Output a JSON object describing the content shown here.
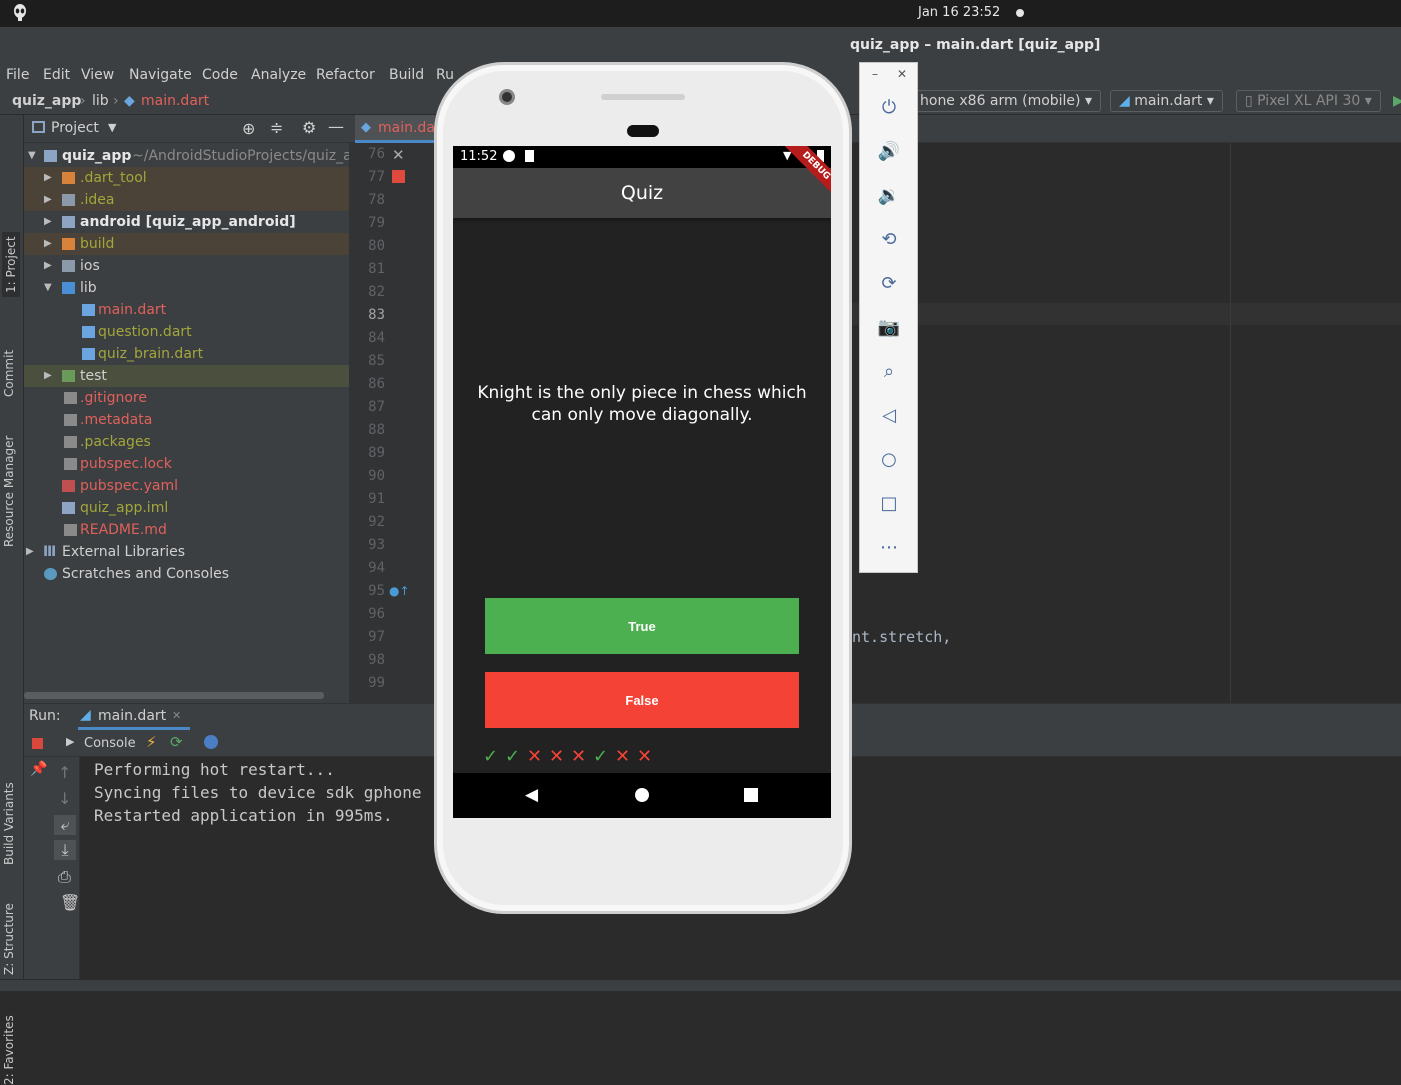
{
  "system": {
    "clock": "Jan 16  23:52"
  },
  "window": {
    "title": "quiz_app – main.dart [quiz_app]"
  },
  "menu": [
    "File",
    "Edit",
    "View",
    "Navigate",
    "Code",
    "Analyze",
    "Refactor",
    "Build",
    "Ru"
  ],
  "breadcrumb": {
    "project": "quiz_app",
    "folder": "lib",
    "file": "main.dart"
  },
  "toolbar": {
    "device_combo": "hone x86 arm (mobile)",
    "config_combo": "main.dart",
    "avd_combo": "Pixel XL API 30"
  },
  "left_stripe": {
    "project": "1: Project",
    "commit": "Commit",
    "resource_manager": "Resource Manager",
    "build_variants": "Build Variants",
    "structure": "Z: Structure",
    "favorites": "2: Favorites"
  },
  "project_panel": {
    "header": "Project",
    "root": {
      "name": "quiz_app",
      "path": "~/AndroidStudioProjects/quiz_a"
    },
    "items": [
      {
        "label": ".dart_tool"
      },
      {
        "label": ".idea"
      },
      {
        "label": "android [quiz_app_android]"
      },
      {
        "label": "build"
      },
      {
        "label": "ios"
      },
      {
        "label": "lib"
      },
      {
        "label": "main.dart"
      },
      {
        "label": "question.dart"
      },
      {
        "label": "quiz_brain.dart"
      },
      {
        "label": "test"
      },
      {
        "label": ".gitignore"
      },
      {
        "label": ".metadata"
      },
      {
        "label": ".packages"
      },
      {
        "label": "pubspec.lock"
      },
      {
        "label": "pubspec.yaml"
      },
      {
        "label": "quiz_app.iml"
      },
      {
        "label": "README.md"
      },
      {
        "label": "External Libraries"
      },
      {
        "label": "Scratches and Consoles"
      }
    ]
  },
  "editor": {
    "tab": "main.da",
    "line_numbers": [
      "76",
      "77",
      "78",
      "79",
      "80",
      "81",
      "82",
      "83",
      "84",
      "85",
      "86",
      "87",
      "88",
      "89",
      "90",
      "91",
      "92",
      "93",
      "94",
      "95",
      "96",
      "97",
      "98",
      "99"
    ],
    "code_fragment": "nt.stretch,"
  },
  "run_panel": {
    "label": "Run:",
    "tab": "main.dart",
    "console_tab": "Console",
    "lines": [
      "Performing hot restart...",
      "Syncing files to device sdk gphone",
      "Restarted application in 995ms."
    ]
  },
  "phone": {
    "time": "11:52",
    "debug_banner": "DEBUG",
    "app_title": "Quiz",
    "question": "Knight is the only piece in chess which can only move diagonally.",
    "true_button": "True",
    "false_button": "False",
    "score_marks": [
      "check",
      "check",
      "cross",
      "cross",
      "cross",
      "check",
      "cross",
      "cross"
    ],
    "colors": {
      "true": "#4caf50",
      "false": "#f44336",
      "check": "#4caf50",
      "cross": "#f44336"
    }
  }
}
